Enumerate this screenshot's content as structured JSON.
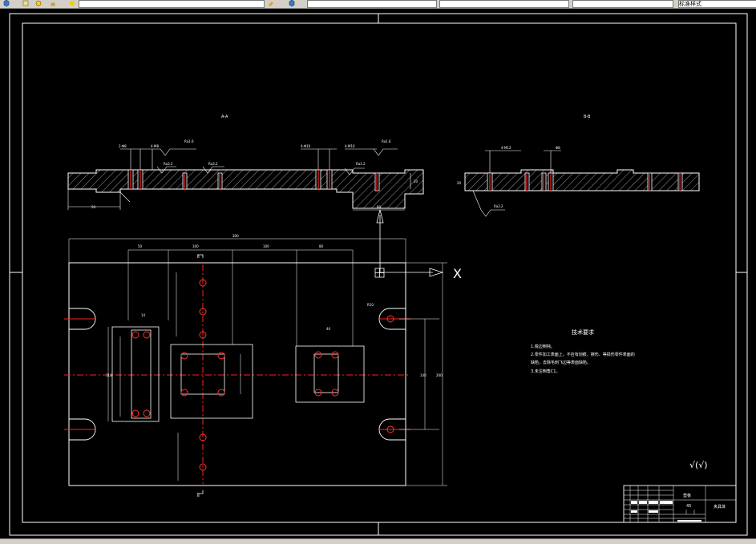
{
  "toolbar": {
    "corner_label": "标准样式"
  },
  "drawing": {
    "section_a_title": "A-A",
    "section_b_title": "B-B",
    "axis_label": "X",
    "tech_requirements": {
      "title": "技术要求",
      "items": [
        "1.锐边倒钝。",
        "2.零件加工表面上，不应有划痕、擦伤、等损伤零件表面的",
        "缺陷，去除毛刺飞边等表面缺陷。",
        "3.未注倒角C1。"
      ]
    },
    "dims": {
      "overall_width": "300",
      "overall_height": "200",
      "seg_left": "50",
      "seg_mid": "100",
      "seg_right": "80"
    },
    "title_block": {
      "part_name": "垫板",
      "material": "45",
      "drawing_name": "夹具体"
    },
    "roughness_note": "√(√)"
  },
  "colors": {
    "background": "#000000",
    "line": "#ffffff",
    "hole": "#ff3030",
    "centerline": "#ff2020",
    "panel": "#d4d0c8"
  }
}
